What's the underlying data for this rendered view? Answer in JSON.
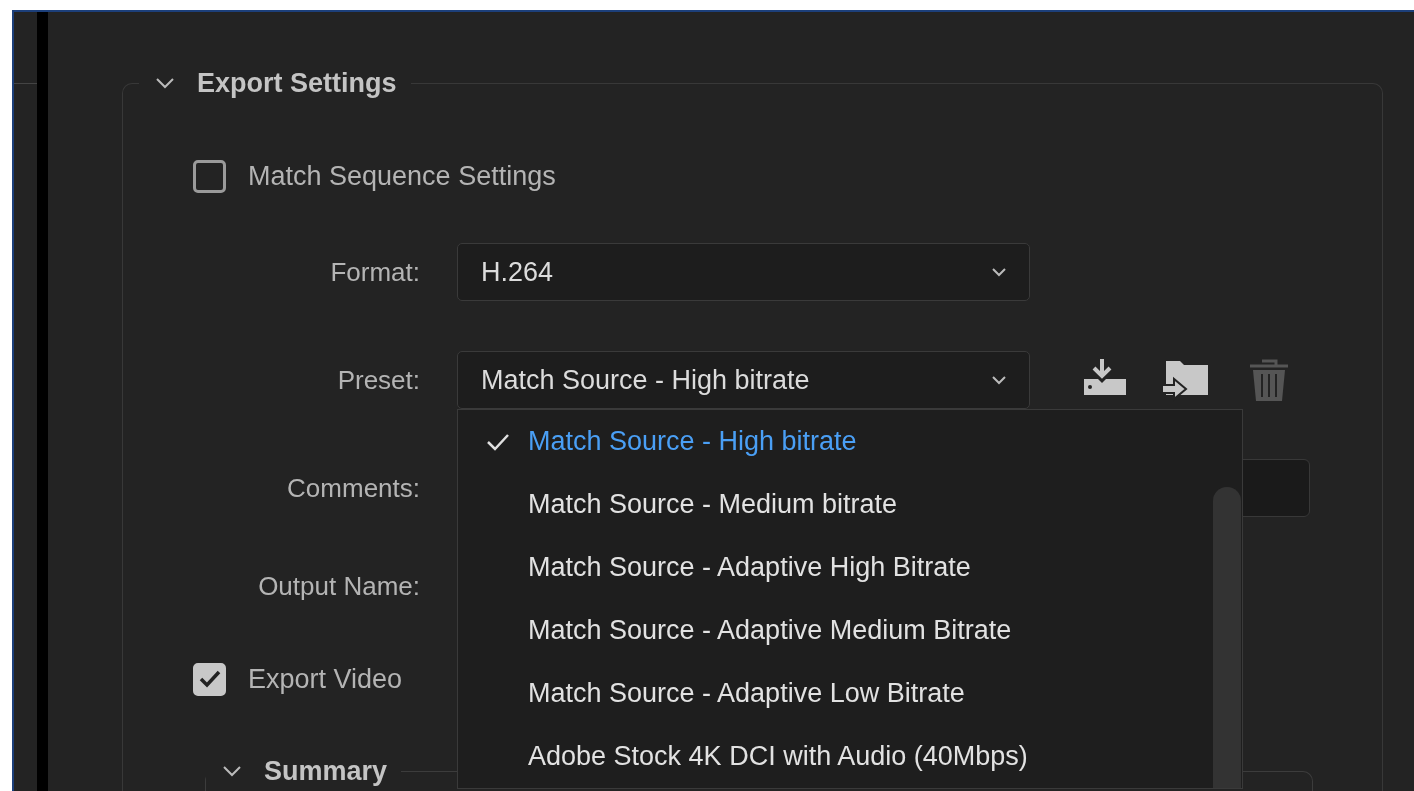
{
  "export_settings": {
    "title": "Export Settings",
    "expanded": true,
    "match_sequence": {
      "label": "Match Sequence Settings",
      "checked": false
    },
    "format": {
      "label": "Format:",
      "value": "H.264"
    },
    "preset": {
      "label": "Preset:",
      "value": "Match Source - High bitrate",
      "expanded": true,
      "actions": [
        {
          "kind": "save",
          "disabled": false
        },
        {
          "kind": "import",
          "disabled": false
        },
        {
          "kind": "delete",
          "disabled": true
        }
      ]
    },
    "comments": {
      "label": "Comments:"
    },
    "output_name": {
      "label": "Output Name:"
    },
    "export_video": {
      "label": "Export Video",
      "checked": true
    },
    "summary": {
      "title": "Summary",
      "expanded": true
    }
  },
  "preset_menu": {
    "items": [
      {
        "label": "Match Source - High bitrate",
        "selected": true
      },
      {
        "label": "Match Source - Medium bitrate",
        "selected": false
      },
      {
        "label": "Match Source - Adaptive High Bitrate",
        "selected": false
      },
      {
        "label": "Match Source - Adaptive Medium Bitrate",
        "selected": false
      },
      {
        "label": "Match Source - Adaptive Low Bitrate",
        "selected": false
      },
      {
        "label": "Adobe Stock 4K DCI with Audio (40Mbps)",
        "selected": false
      }
    ]
  }
}
